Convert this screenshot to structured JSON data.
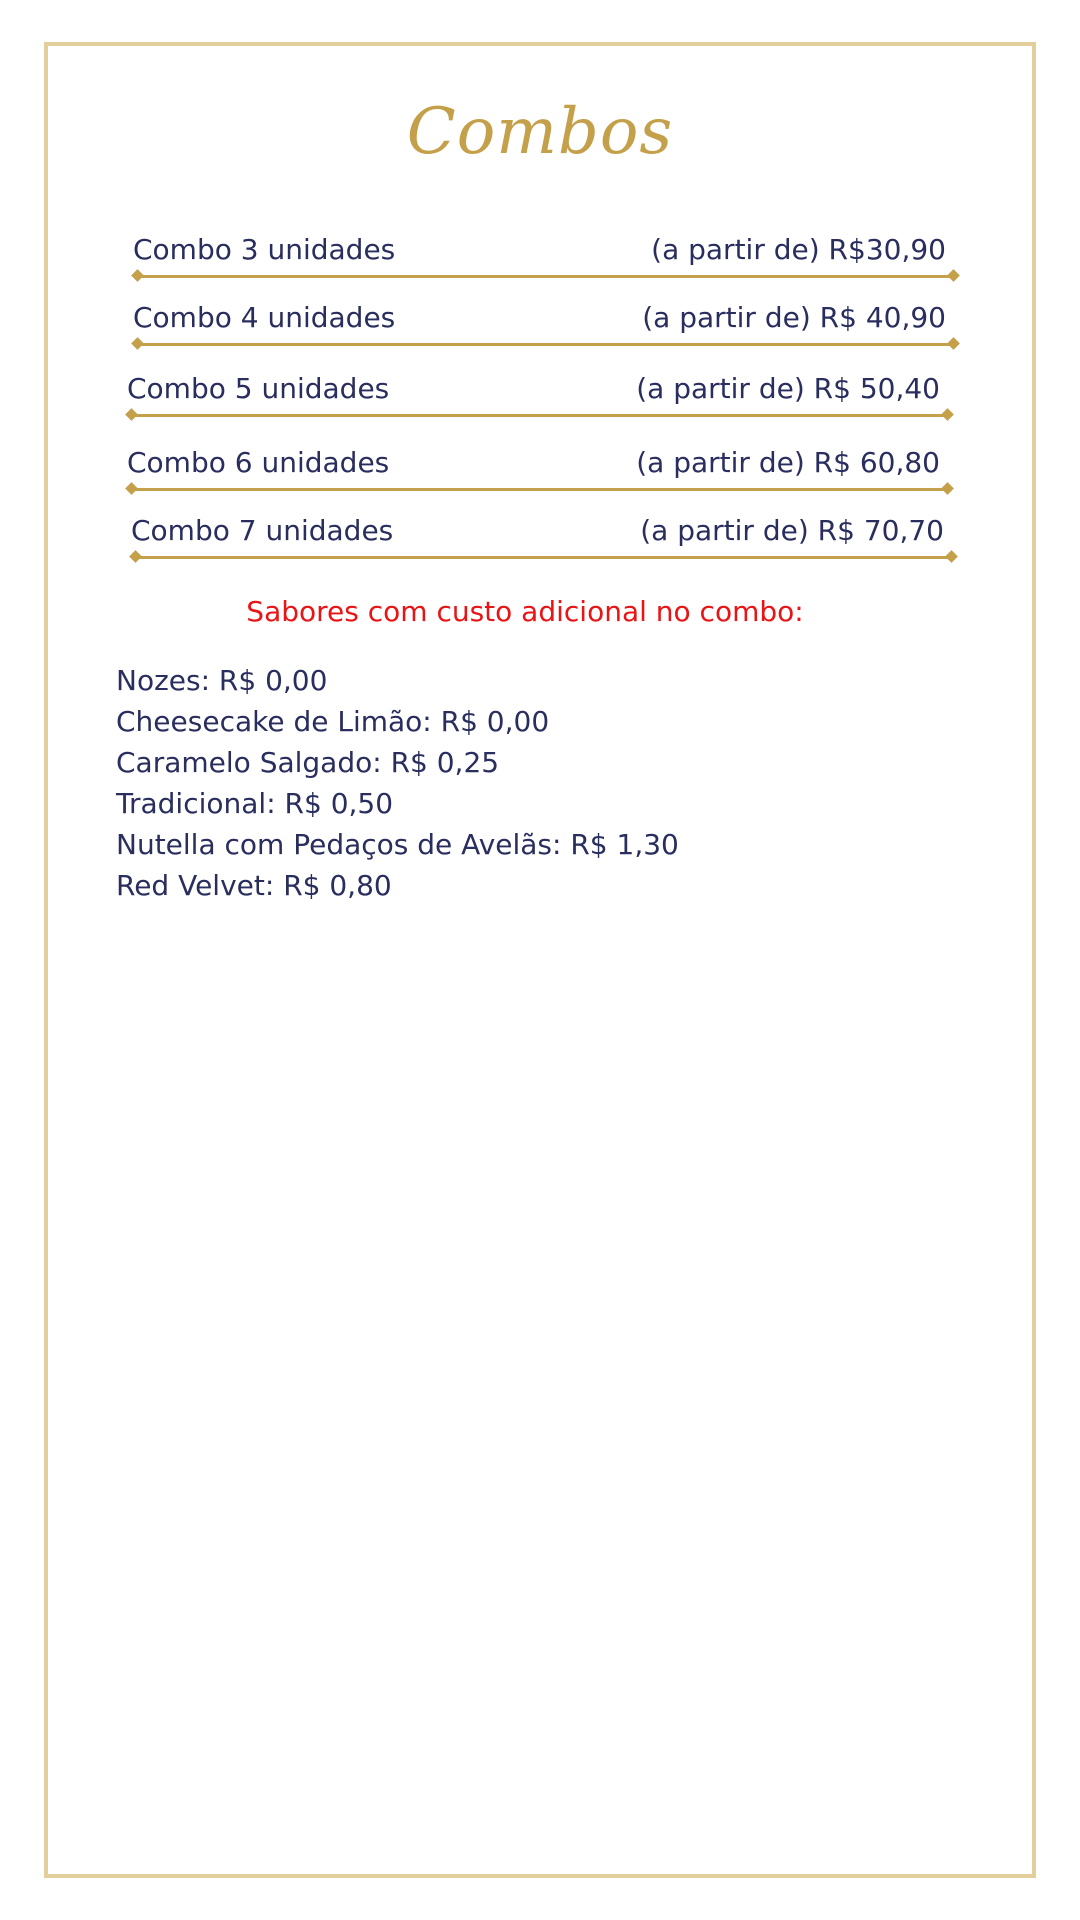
{
  "menu": {
    "title": "Combos",
    "combos": [
      {
        "name": "Combo 3 unidades",
        "price": "(a partir de) R$30,90"
      },
      {
        "name": "Combo 4 unidades",
        "price": "(a partir de) R$ 40,90"
      },
      {
        "name": "Combo 5 unidades",
        "price": "(a partir de) R$ 50,40"
      },
      {
        "name": "Combo 6 unidades",
        "price": "(a partir de) R$ 60,80"
      },
      {
        "name": "Combo 7 unidades",
        "price": "(a partir de) R$ 70,70"
      }
    ],
    "extras_title": "Sabores com custo adicional no combo:",
    "flavors": [
      "Nozes: R$ 0,00",
      "Cheesecake de Limão: R$ 0,00",
      "Caramelo Salgado: R$ 0,25",
      "Tradicional: R$ 0,50",
      "Nutella com Pedaços de Avelãs: R$ 1,30",
      "Red Velvet: R$ 0,80"
    ]
  },
  "colors": {
    "gold": "#c4a04a",
    "border": "#e3cf9c",
    "navy": "#2a2e5e",
    "red": "#e81416"
  }
}
